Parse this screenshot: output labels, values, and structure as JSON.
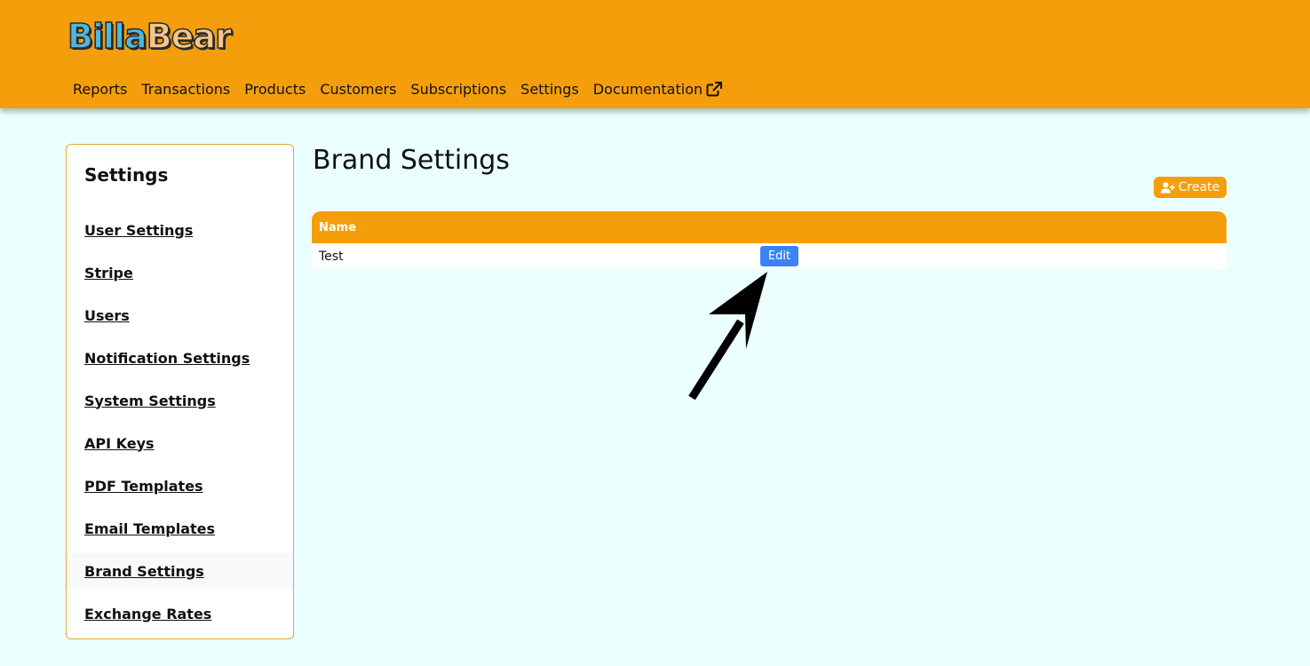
{
  "header": {
    "logo": {
      "part1": "Billa",
      "part2": "Bear"
    },
    "nav": [
      {
        "label": "Reports"
      },
      {
        "label": "Transactions"
      },
      {
        "label": "Products"
      },
      {
        "label": "Customers"
      },
      {
        "label": "Subscriptions"
      },
      {
        "label": "Settings"
      },
      {
        "label": "Documentation",
        "icon": "external-link-icon"
      }
    ]
  },
  "sidebar": {
    "title": "Settings",
    "items": [
      {
        "label": "User Settings"
      },
      {
        "label": "Stripe"
      },
      {
        "label": "Users"
      },
      {
        "label": "Notification Settings"
      },
      {
        "label": "System Settings"
      },
      {
        "label": "API Keys"
      },
      {
        "label": "PDF Templates"
      },
      {
        "label": "Email Templates"
      },
      {
        "label": "Brand Settings",
        "active": true
      },
      {
        "label": "Exchange Rates"
      }
    ]
  },
  "main": {
    "title": "Brand Settings",
    "create_label": "Create",
    "create_icon": "user-plus-icon",
    "table": {
      "columns": [
        "Name"
      ],
      "rows": [
        {
          "name": "Test",
          "edit_label": "Edit"
        }
      ]
    }
  },
  "colors": {
    "brand": "#f59e0b",
    "background": "#ebffff",
    "edit_button": "#3b82f6"
  }
}
